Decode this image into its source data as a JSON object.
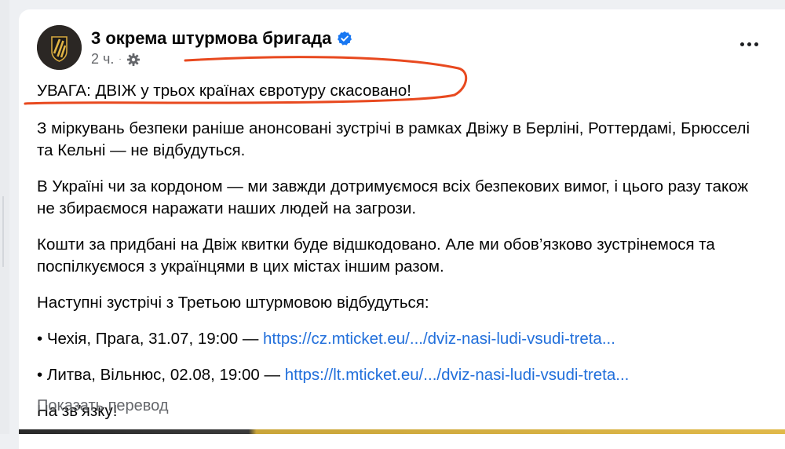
{
  "post": {
    "page_name": "3 окрема штурмова бригада",
    "timestamp": "2 ч.",
    "headline": "УВАГА: ДВІЖ у трьох країнах євротуру скасовано!",
    "paragraphs": [
      "З міркувань безпеки раніше анонсовані зустрічі в рамках Двіжу в Берліні, Роттердамі, Брюсселі та Кельні — не відбудуться.",
      "В Україні чи за кордоном — ми завжди дотримуємося всіх безпекових вимог, і цього разу також не збираємося наражати наших людей на загрози.",
      "Кошти за придбані на Двіж квитки буде відшкодовано. Але ми обов’язково зустрінемося та поспілкуємося з українцями в цих містах іншим разом.",
      "Наступні зустрічі з Третьою штурмовою відбудуться:"
    ],
    "events": [
      {
        "text": "• Чехія, Прага, 31.07, 19:00 — ",
        "link": "https://cz.mticket.eu/.../dviz-nasi-ludi-vsudi-treta..."
      },
      {
        "text": "• Литва, Вільнюс, 02.08, 19:00 — ",
        "link": "https://lt.mticket.eu/.../dviz-nasi-ludi-vsudi-treta..."
      }
    ],
    "closing": "На зв’язку!",
    "translate_label": "Показать перевод"
  },
  "icons": {
    "verified": "verified-badge-icon",
    "privacy": "gear-icon",
    "more": "more-options-icon"
  },
  "colors": {
    "link": "#216fdb",
    "verified": "#1877f2",
    "highlight_stroke": "#e8491f"
  }
}
